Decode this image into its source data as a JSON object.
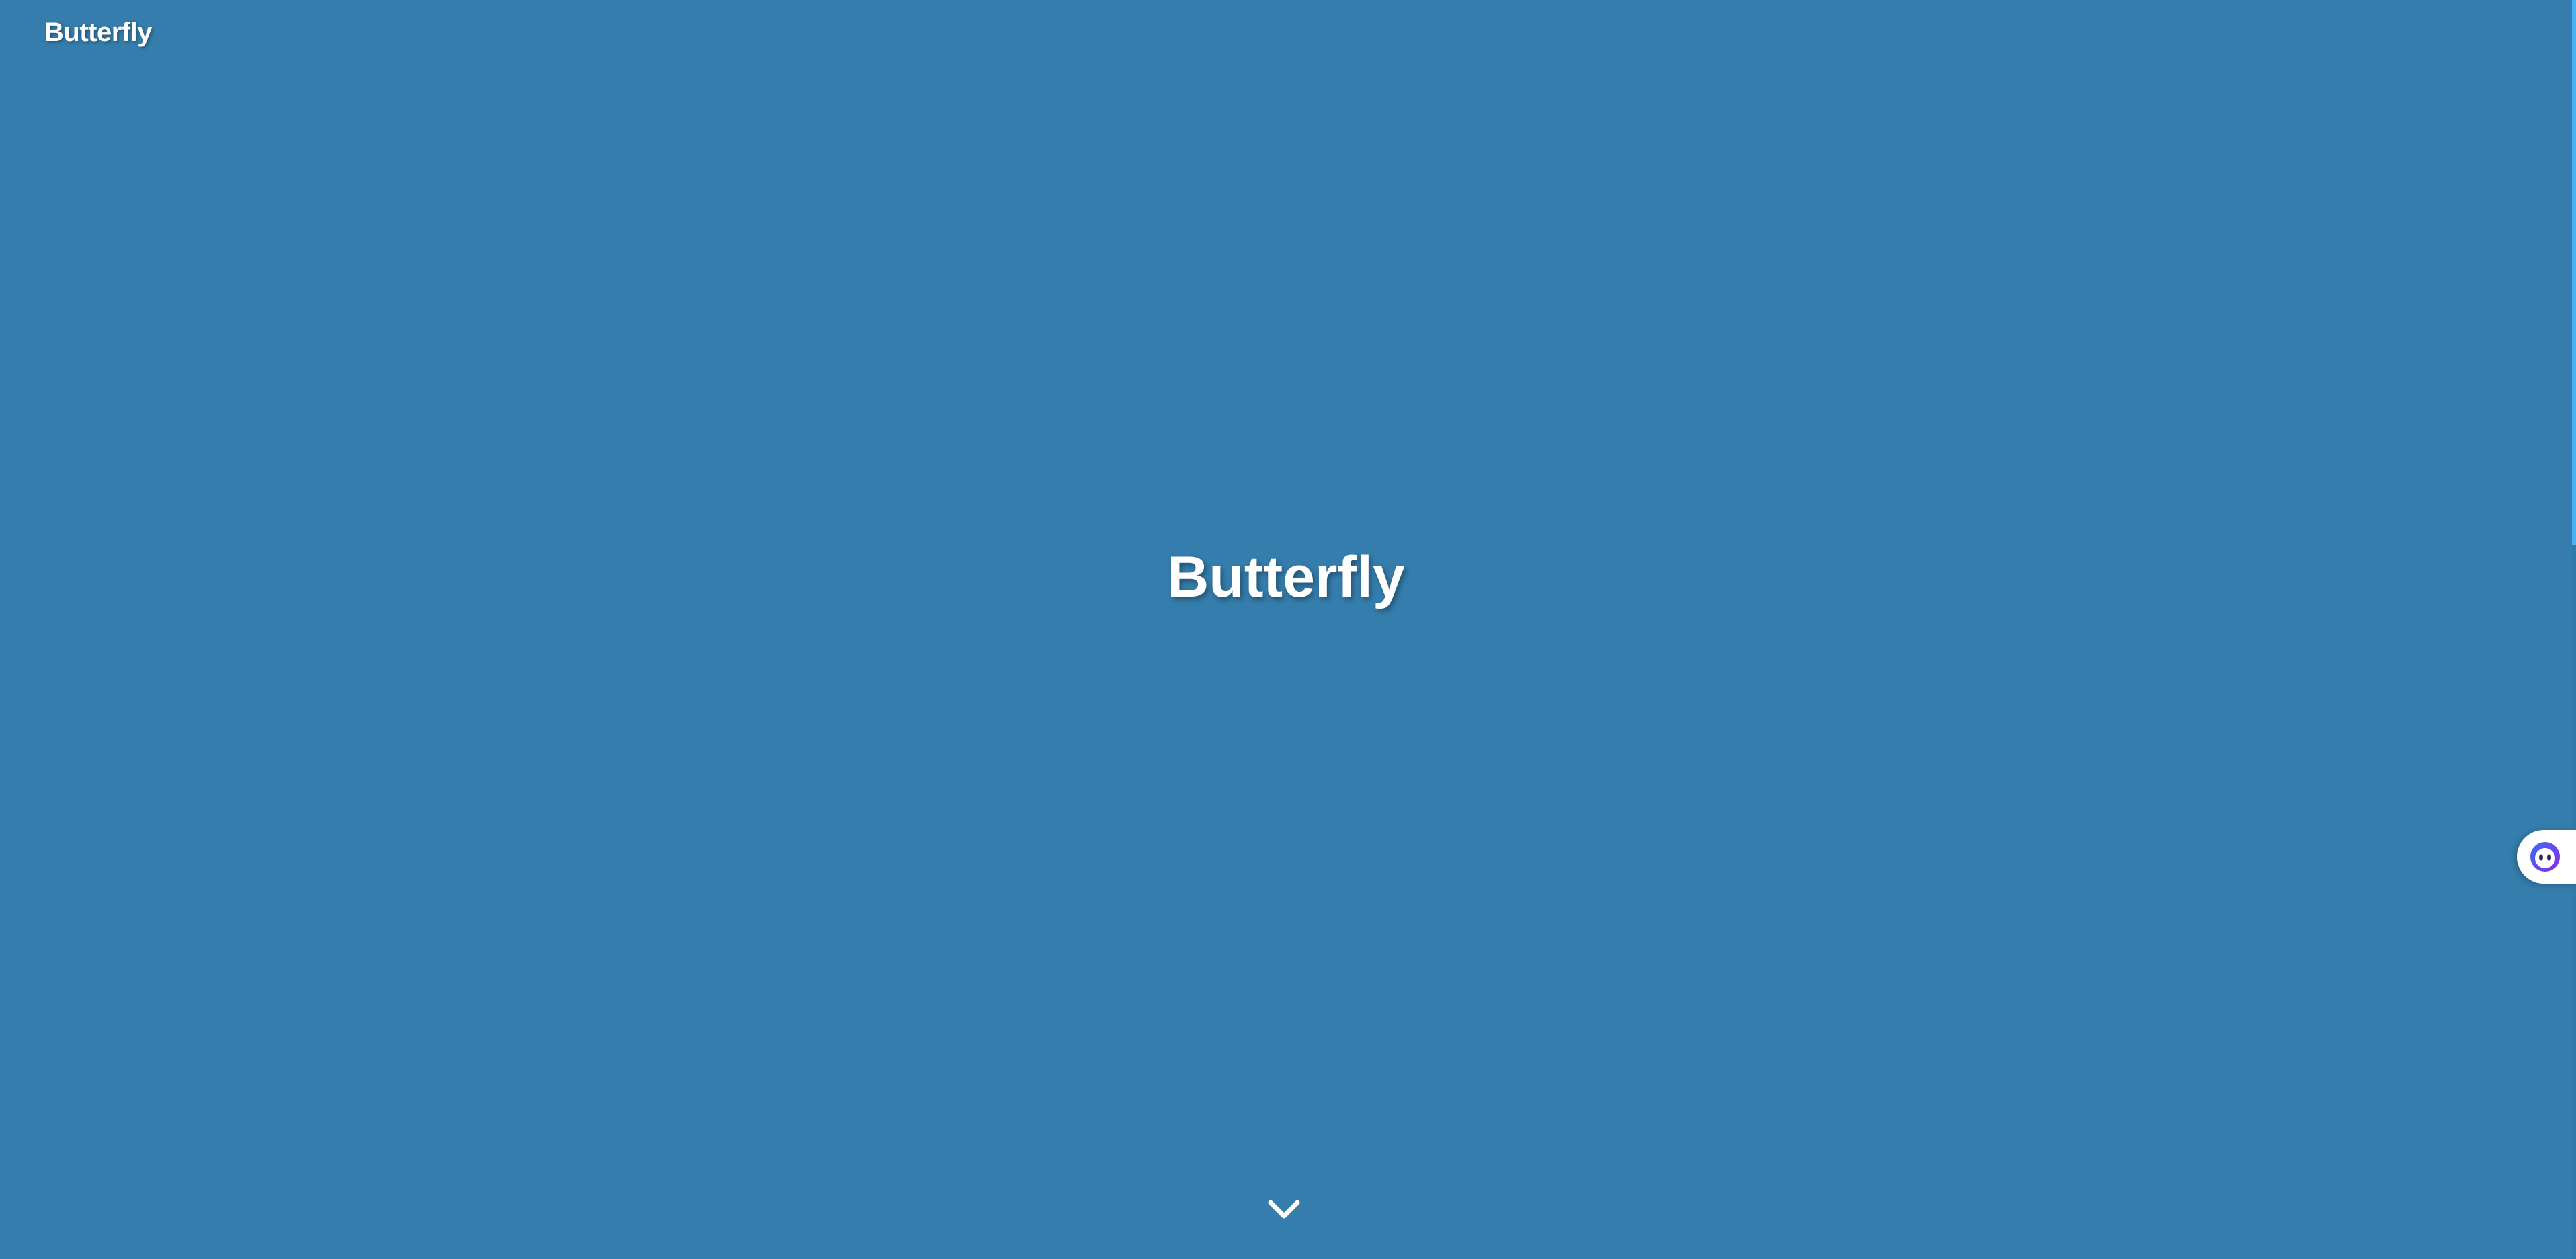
{
  "header": {
    "site_name": "Butterfly"
  },
  "hero": {
    "title": "Butterfly",
    "scroll_icon": "chevron-down-icon"
  },
  "widget": {
    "icon": "chat-assistant-icon"
  },
  "colors": {
    "background": "#357dac",
    "text": "#ffffff",
    "scrollbar_thumb": "#49b1f5",
    "widget_accent": "#6a3df0"
  }
}
